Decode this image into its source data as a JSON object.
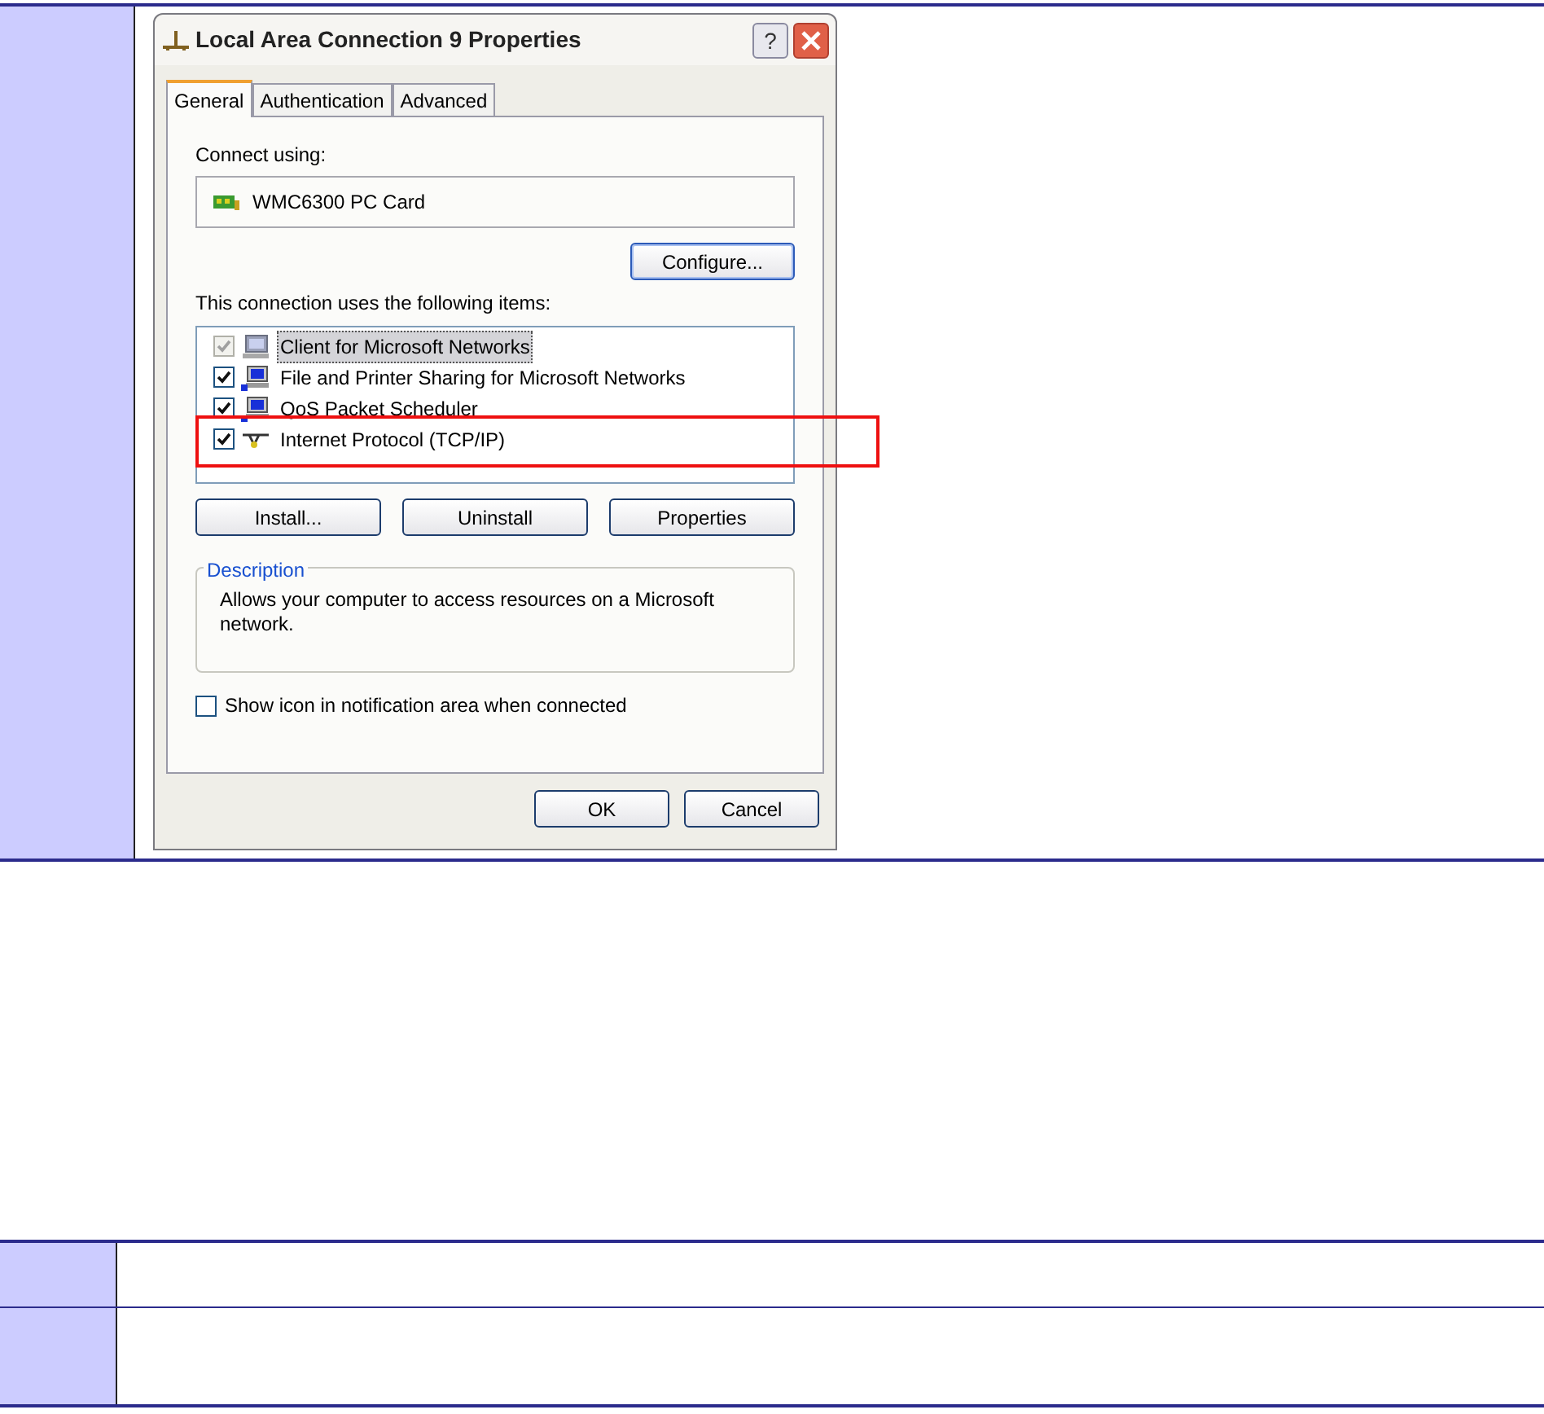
{
  "dialog": {
    "title": "Local Area Connection 9 Properties",
    "help_button": "?",
    "tabs": [
      {
        "label": "General",
        "selected": true
      },
      {
        "label": "Authentication",
        "selected": false
      },
      {
        "label": "Advanced",
        "selected": false
      }
    ],
    "connect_using_label": "Connect using:",
    "adapter": "WMC6300 PC Card",
    "configure_button": "Configure...",
    "items_label": "This connection uses the following items:",
    "items": [
      {
        "kind": "client",
        "label": "Client for Microsoft Networks",
        "checked": true,
        "disabled": true,
        "selected": true
      },
      {
        "kind": "service",
        "label": "File and Printer Sharing for Microsoft Networks",
        "checked": true,
        "disabled": false,
        "selected": false
      },
      {
        "kind": "service",
        "label": "QoS Packet Scheduler",
        "checked": true,
        "disabled": false,
        "selected": false
      },
      {
        "kind": "protocol",
        "label": "Internet Protocol (TCP/IP)",
        "checked": true,
        "disabled": false,
        "selected": false
      }
    ],
    "item_buttons": [
      "Install...",
      "Uninstall",
      "Properties"
    ],
    "description_title": "Description",
    "description": "Allows your computer to access resources on a Microsoft network.",
    "show_icon": {
      "label": "Show icon in notification area when connected",
      "checked": false
    },
    "buttons": [
      "OK",
      "Cancel"
    ]
  }
}
